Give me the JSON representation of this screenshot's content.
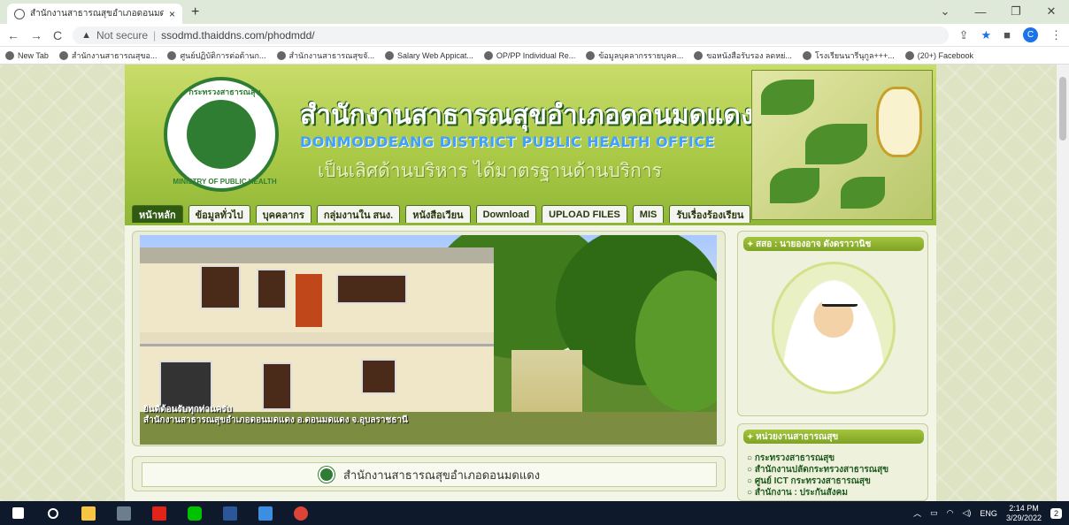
{
  "browser": {
    "tab_title": "สำนักงานสาธารณสุขอำเภอดอนมดแดง",
    "tab_close": "×",
    "new_tab": "+",
    "url_warning": "Not secure",
    "url": "ssodmd.thaiddns.com/phodmdd/",
    "profile_initial": "C"
  },
  "bookmarks": [
    {
      "label": "New Tab",
      "icon": "globe-icon"
    },
    {
      "label": "สำนักงานสาธารณสุขอ...",
      "icon": "globe-icon"
    },
    {
      "label": "ศูนย์ปฏิบัติการต่อต้านก...",
      "icon": "globe-icon"
    },
    {
      "label": "สำนักงานสาธารณสุขจั...",
      "icon": "globe-icon"
    },
    {
      "label": "Salary Web Appicat...",
      "icon": "globe-icon"
    },
    {
      "label": "OP/PP Individual Re...",
      "icon": "op-icon"
    },
    {
      "label": "ข้อมูลบุคลากรรายบุคค...",
      "icon": "globe-icon"
    },
    {
      "label": "ขอหนังสือรับรอง ลดหย่...",
      "icon": "award-icon"
    },
    {
      "label": "โรงเรียนนารีนุกูล+++...",
      "icon": "school-icon"
    },
    {
      "label": "(20+) Facebook",
      "icon": "facebook-icon"
    }
  ],
  "header": {
    "title_th": "สำนักงานสาธารณสุขอำเภอดอนมดแดง",
    "title_en": "DONMODDEANG DISTRICT PUBLIC HEALTH OFFICE",
    "slogan": "เป็นเลิศด้านบริหาร  ได้มาตรฐานด้านบริการ",
    "seal_top": "กระทรวงสาธารณสุข",
    "seal_bottom": "MINISTRY OF PUBLIC HEALTH"
  },
  "menu": [
    {
      "label": "หน้าหลัก",
      "active": true
    },
    {
      "label": "ข้อมูลทั่วไป",
      "active": false
    },
    {
      "label": "บุคคลากร",
      "active": false
    },
    {
      "label": "กลุ่มงานใน สนง.",
      "active": false
    },
    {
      "label": "หนังสือเวียน",
      "active": false
    },
    {
      "label": "Download",
      "active": false
    },
    {
      "label": "UPLOAD FILES",
      "active": false
    },
    {
      "label": "MIS",
      "active": false
    },
    {
      "label": "รับเรื่องร้องเรียน",
      "active": false
    }
  ],
  "slideshow": {
    "caption_line1": "ยินดีต้อนรับทุกท่านครับ",
    "caption_line2": "สำนักงานสาธารณสุขอำเภอดอนมดแดง อ.ดอนมดแดง จ.อุบลราชธานี"
  },
  "office_name": "สำนักงานสาธารณสุขอำเภอดอนมดแดง",
  "sidebar": {
    "director_header": "สสอ : นายองอาจ ดังดราวานิช",
    "units_header": "หน่วยงานสาธารณสุข",
    "units": [
      "กระทรวงสาธารณสุข",
      "สำนักงานปลัดกระทรวงสาธารณสุข",
      "ศูนย์ ICT กระทรวงสาธารณสุข",
      "สำนักงาน : ประกันสังคม"
    ]
  },
  "taskbar": {
    "language": "ENG",
    "time": "2:14 PM",
    "date": "3/29/2022",
    "notifications": "2"
  }
}
